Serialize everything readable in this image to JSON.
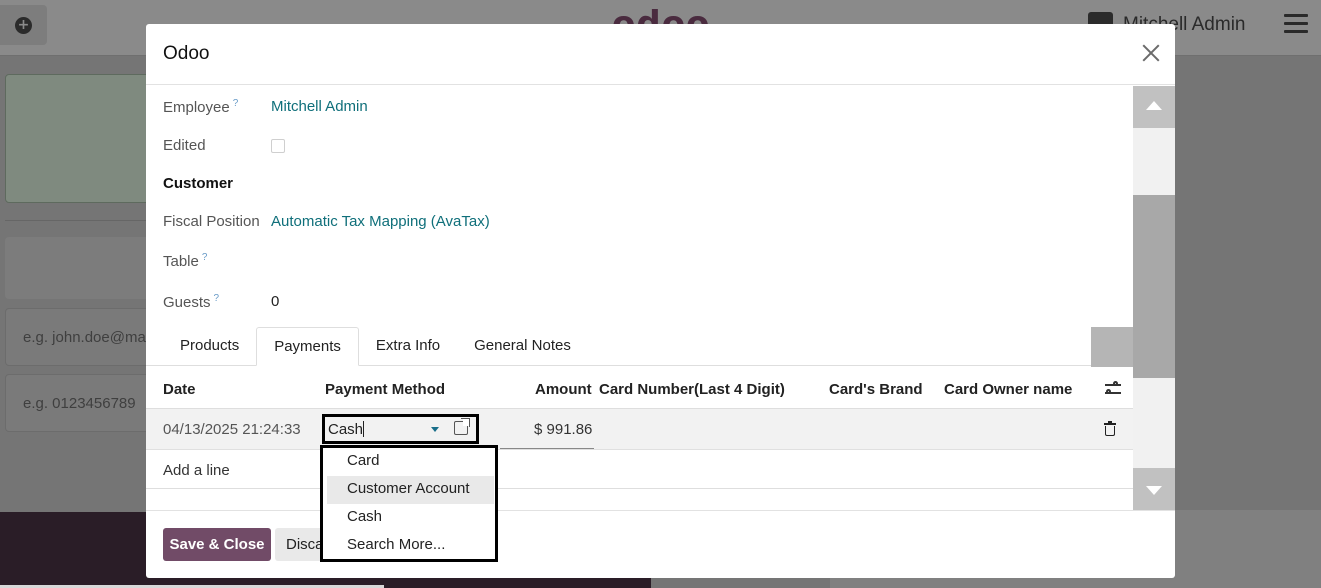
{
  "background": {
    "logo_text": "odoo",
    "user_name": "Mitchell Admin",
    "email_placeholder": "e.g. john.doe@mail",
    "phone_placeholder": "e.g. 0123456789"
  },
  "modal": {
    "title": "Odoo",
    "fields": {
      "employee_label": "Employee",
      "employee_value": "Mitchell Admin",
      "edited_label": "Edited",
      "section_customer": "Customer",
      "fiscal_label": "Fiscal Position",
      "fiscal_value": "Automatic Tax Mapping (AvaTax)",
      "table_label": "Table",
      "guests_label": "Guests",
      "guests_value": "0",
      "help_mark": "?"
    },
    "tabs": [
      "Products",
      "Payments",
      "Extra Info",
      "General Notes"
    ],
    "active_tab": "Payments",
    "table": {
      "headers": [
        "Date",
        "Payment Method",
        "Amount",
        "Card Number(Last 4 Digit)",
        "Card's Brand",
        "Card Owner name"
      ],
      "row": {
        "date": "04/13/2025 21:24:33",
        "payment_method": "Cash",
        "amount": "$ 991.86"
      },
      "add_line": "Add a line"
    },
    "dropdown_options": [
      "Card",
      "Customer Account",
      "Cash",
      "Search More..."
    ],
    "highlighted_option": "Customer Account",
    "buttons": {
      "save_close": "Save & Close",
      "discard": "Discard"
    }
  },
  "colors": {
    "primary": "#714b67",
    "link": "#0f6f7a",
    "overlay": "#757575"
  }
}
